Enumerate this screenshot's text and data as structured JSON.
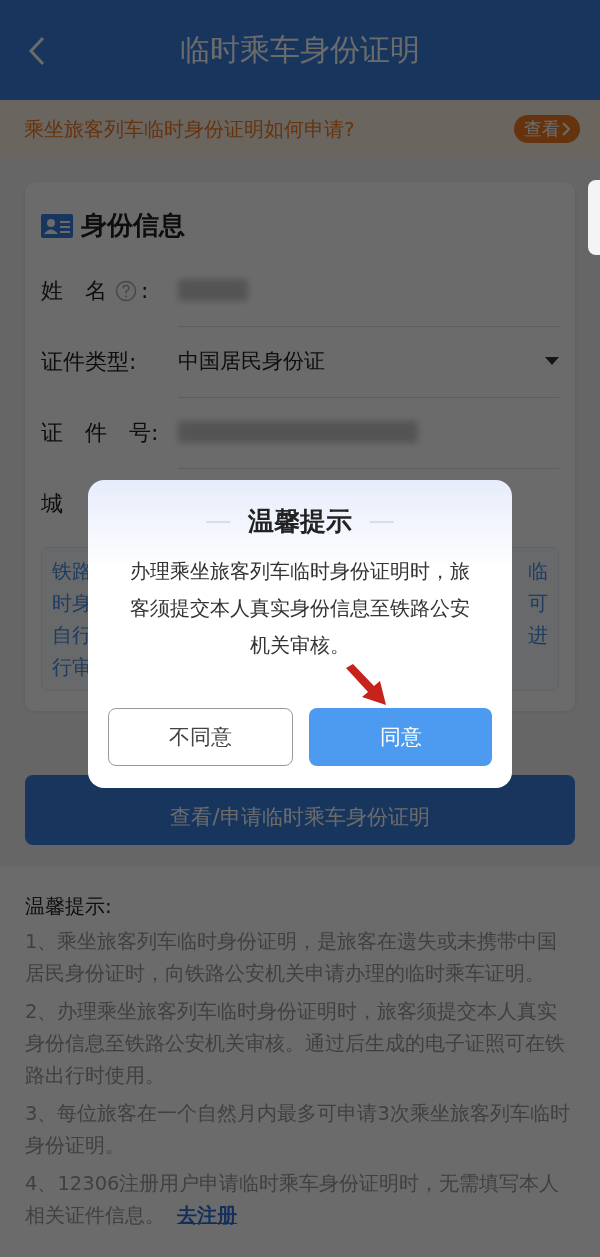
{
  "header": {
    "title": "临时乘车身份证明"
  },
  "banner": {
    "text": "乘坐旅客列车临时身份证明如何申请?",
    "button": "查看"
  },
  "card": {
    "title": "身份信息",
    "fields": [
      {
        "kind": "redacted",
        "label": "姓　名",
        "help": true,
        "colon": ":"
      },
      {
        "kind": "select",
        "label": "证件类型:",
        "value": "中国居民身份证"
      },
      {
        "kind": "redacted",
        "label": "证　件　号:"
      },
      {
        "kind": "partial",
        "label": "城"
      }
    ],
    "notice": {
      "left_lines": [
        "铁路",
        "时身",
        "自行",
        "行审"
      ],
      "right_lines": [
        "临",
        "可",
        "进"
      ]
    }
  },
  "submit_button": "查看/申请临时乘车身份证明",
  "tips": {
    "title": "温馨提示:",
    "items": [
      {
        "text": "1、乘坐旅客列车临时身份证明，是旅客在遗失或未携带中国居民身份证时，向铁路公安机关申请办理的临时乘车证明。"
      },
      {
        "text": "2、办理乘坐旅客列车临时身份证明时，旅客须提交本人真实身份信息至铁路公安机关审核。通过后生成的电子证照可在铁路出行时使用。"
      },
      {
        "text": "3、每位旅客在一个自然月内最多可申请3次乘坐旅客列车临时身份证明。"
      },
      {
        "text": "4、12306注册用户申请临时乘车身份证明时，无需填写本人相关证件信息。",
        "link": "去注册"
      }
    ]
  },
  "dialog": {
    "title": "温馨提示",
    "message": "办理乘坐旅客列车临时身份证明时，旅客须提交本人真实身份信息至铁路公安机关审核。",
    "buttons": [
      {
        "label": "不同意",
        "primary": false
      },
      {
        "label": "同意",
        "primary": true
      }
    ]
  }
}
